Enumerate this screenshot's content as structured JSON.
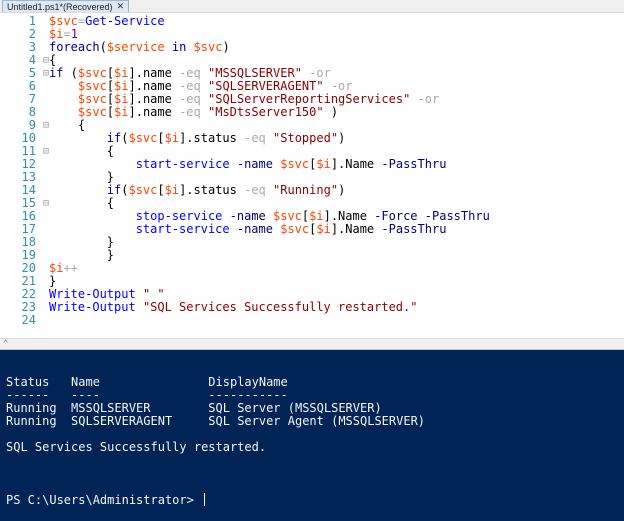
{
  "tab": {
    "title": "Untitled1.ps1*(Recovered)",
    "close": "✕"
  },
  "editor": {
    "lines": [
      {
        "n": "1",
        "fold": "",
        "tokens": [
          [
            "var",
            "$svc"
          ],
          [
            "op",
            "="
          ],
          [
            "cmd",
            "Get-Service"
          ]
        ]
      },
      {
        "n": "2",
        "fold": "",
        "tokens": [
          [
            "var",
            "$i"
          ],
          [
            "op",
            "="
          ],
          [
            "num",
            "1"
          ]
        ]
      },
      {
        "n": "3",
        "fold": "",
        "tokens": [
          [
            "kw",
            "foreach"
          ],
          [
            "prop",
            "("
          ],
          [
            "var",
            "$service"
          ],
          [
            "prop",
            " "
          ],
          [
            "kw",
            "in"
          ],
          [
            "prop",
            " "
          ],
          [
            "var",
            "$svc"
          ],
          [
            "prop",
            ")"
          ]
        ]
      },
      {
        "n": "4",
        "fold": "⊟",
        "tokens": [
          [
            "prop",
            "{"
          ]
        ]
      },
      {
        "n": "5",
        "fold": "⊟",
        "tokens": [
          [
            "kw",
            "if"
          ],
          [
            "prop",
            " ("
          ],
          [
            "var",
            "$svc"
          ],
          [
            "prop",
            "["
          ],
          [
            "var",
            "$i"
          ],
          [
            "prop",
            "].name "
          ],
          [
            "op",
            "-eq"
          ],
          [
            "prop",
            " "
          ],
          [
            "str",
            "\"MSSQLSERVER\""
          ],
          [
            "prop",
            " "
          ],
          [
            "op",
            "-or"
          ]
        ]
      },
      {
        "n": "6",
        "fold": "",
        "tokens": [
          [
            "prop",
            "    "
          ],
          [
            "var",
            "$svc"
          ],
          [
            "prop",
            "["
          ],
          [
            "var",
            "$i"
          ],
          [
            "prop",
            "].name "
          ],
          [
            "op",
            "-eq"
          ],
          [
            "prop",
            " "
          ],
          [
            "str",
            "\"SQLSERVERAGENT\""
          ],
          [
            "prop",
            " "
          ],
          [
            "op",
            "-or"
          ]
        ]
      },
      {
        "n": "7",
        "fold": "",
        "tokens": [
          [
            "prop",
            "    "
          ],
          [
            "var",
            "$svc"
          ],
          [
            "prop",
            "["
          ],
          [
            "var",
            "$i"
          ],
          [
            "prop",
            "].name "
          ],
          [
            "op",
            "-eq"
          ],
          [
            "prop",
            " "
          ],
          [
            "str",
            "\"SQLServerReportingServices\""
          ],
          [
            "prop",
            " "
          ],
          [
            "op",
            "-or"
          ]
        ]
      },
      {
        "n": "8",
        "fold": "",
        "tokens": [
          [
            "prop",
            "    "
          ],
          [
            "var",
            "$svc"
          ],
          [
            "prop",
            "["
          ],
          [
            "var",
            "$i"
          ],
          [
            "prop",
            "].name "
          ],
          [
            "op",
            "-eq"
          ],
          [
            "prop",
            " "
          ],
          [
            "str",
            "\"MsDtsServer150\""
          ],
          [
            "prop",
            " )"
          ]
        ]
      },
      {
        "n": "9",
        "fold": "⊟",
        "tokens": [
          [
            "prop",
            "    {"
          ]
        ]
      },
      {
        "n": "10",
        "fold": "",
        "tokens": [
          [
            "prop",
            "        "
          ],
          [
            "kw",
            "if"
          ],
          [
            "prop",
            "("
          ],
          [
            "var",
            "$svc"
          ],
          [
            "prop",
            "["
          ],
          [
            "var",
            "$i"
          ],
          [
            "prop",
            "].status "
          ],
          [
            "op",
            "-eq"
          ],
          [
            "prop",
            " "
          ],
          [
            "str",
            "\"Stopped\""
          ],
          [
            "prop",
            ")"
          ]
        ]
      },
      {
        "n": "11",
        "fold": "⊟",
        "tokens": [
          [
            "prop",
            "        {"
          ]
        ]
      },
      {
        "n": "12",
        "fold": "",
        "tokens": [
          [
            "prop",
            "            "
          ],
          [
            "cmd",
            "start-service"
          ],
          [
            "prop",
            " "
          ],
          [
            "param",
            "-name"
          ],
          [
            "prop",
            " "
          ],
          [
            "var",
            "$svc"
          ],
          [
            "prop",
            "["
          ],
          [
            "var",
            "$i"
          ],
          [
            "prop",
            "].Name "
          ],
          [
            "param",
            "-PassThru"
          ]
        ]
      },
      {
        "n": "13",
        "fold": "",
        "tokens": [
          [
            "prop",
            "        }"
          ]
        ]
      },
      {
        "n": "14",
        "fold": "",
        "tokens": [
          [
            "prop",
            "        "
          ],
          [
            "kw",
            "if"
          ],
          [
            "prop",
            "("
          ],
          [
            "var",
            "$svc"
          ],
          [
            "prop",
            "["
          ],
          [
            "var",
            "$i"
          ],
          [
            "prop",
            "].status "
          ],
          [
            "op",
            "-eq"
          ],
          [
            "prop",
            " "
          ],
          [
            "str",
            "\"Running\""
          ],
          [
            "prop",
            ")"
          ]
        ]
      },
      {
        "n": "15",
        "fold": "⊟",
        "tokens": [
          [
            "prop",
            "        {"
          ]
        ]
      },
      {
        "n": "16",
        "fold": "",
        "tokens": [
          [
            "prop",
            "            "
          ],
          [
            "cmd",
            "stop-service"
          ],
          [
            "prop",
            " "
          ],
          [
            "param",
            "-name"
          ],
          [
            "prop",
            " "
          ],
          [
            "var",
            "$svc"
          ],
          [
            "prop",
            "["
          ],
          [
            "var",
            "$i"
          ],
          [
            "prop",
            "].Name "
          ],
          [
            "param",
            "-Force"
          ],
          [
            "prop",
            " "
          ],
          [
            "param",
            "-PassThru"
          ]
        ]
      },
      {
        "n": "17",
        "fold": "",
        "tokens": [
          [
            "prop",
            "            "
          ],
          [
            "cmd",
            "start-service"
          ],
          [
            "prop",
            " "
          ],
          [
            "param",
            "-name"
          ],
          [
            "prop",
            " "
          ],
          [
            "var",
            "$svc"
          ],
          [
            "prop",
            "["
          ],
          [
            "var",
            "$i"
          ],
          [
            "prop",
            "].Name "
          ],
          [
            "param",
            "-PassThru"
          ]
        ]
      },
      {
        "n": "18",
        "fold": "",
        "tokens": [
          [
            "prop",
            "        }"
          ]
        ]
      },
      {
        "n": "19",
        "fold": "",
        "tokens": [
          [
            "prop",
            "        }"
          ]
        ]
      },
      {
        "n": "20",
        "fold": "",
        "tokens": [
          [
            "var",
            "$i"
          ],
          [
            "op",
            "++"
          ]
        ]
      },
      {
        "n": "21",
        "fold": "",
        "tokens": [
          [
            "prop",
            "}"
          ]
        ]
      },
      {
        "n": "22",
        "fold": "",
        "tokens": [
          [
            "cmd",
            "Write-Output"
          ],
          [
            "prop",
            " "
          ],
          [
            "str",
            "\" \""
          ]
        ]
      },
      {
        "n": "23",
        "fold": "",
        "tokens": [
          [
            "cmd",
            "Write-Output"
          ],
          [
            "prop",
            " "
          ],
          [
            "str",
            "\"SQL Services Successfully restarted.\""
          ]
        ]
      },
      {
        "n": "24",
        "fold": "",
        "tokens": []
      }
    ]
  },
  "splitter": {
    "arrow": "⌃"
  },
  "console": {
    "header": "Status   Name               DisplayName",
    "underline": "------   ----               -----------",
    "rows": [
      "Running  MSSQLSERVER        SQL Server (MSSQLSERVER)",
      "Running  SQLSERVERAGENT     SQL Server Agent (MSSQLSERVER)"
    ],
    "message": "SQL Services Successfully restarted.",
    "prompt": "PS C:\\Users\\Administrator> "
  },
  "colors": {
    "variable": "#ff4500",
    "command": "#0000ff",
    "keyword": "#00008b",
    "string": "#8b0000",
    "operator": "#a9a9a9",
    "parameter": "#000080",
    "line_number": "#2b91af",
    "console_bg": "#012456",
    "console_fg": "#f5f5f5"
  }
}
